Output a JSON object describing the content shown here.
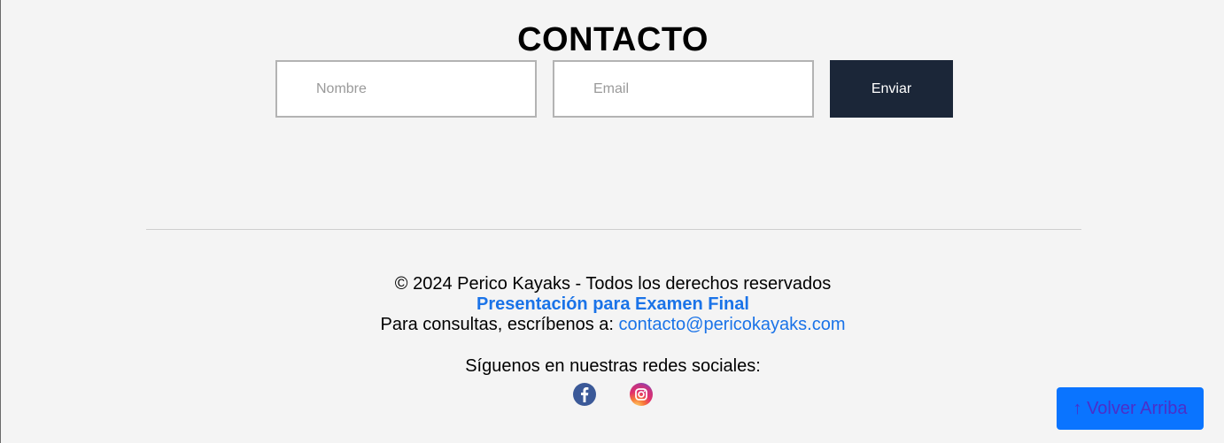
{
  "contact": {
    "title": "CONTACTO",
    "name_placeholder": "Nombre",
    "email_placeholder": "Email",
    "submit_label": "Enviar"
  },
  "footer": {
    "copyright": "© 2024 Perico Kayaks - Todos los derechos reservados",
    "subtitle": "Presentación para Examen Final",
    "consult_text": "Para consultas, escríbenos a: ",
    "email_link": "contacto@pericokayaks.com",
    "social_heading": "Síguenos en nuestras redes sociales:",
    "social_icons": [
      "facebook-icon",
      "instagram-icon"
    ]
  },
  "scroll_top": {
    "label": "↑ Volver Arriba"
  },
  "colors": {
    "background": "#f4f4f4",
    "submit_button": "#1b2638",
    "link": "#1a73e8",
    "scroll_button": "#0a74ff",
    "scroll_button_text": "#4b2fc9",
    "facebook": "#3b5998"
  }
}
